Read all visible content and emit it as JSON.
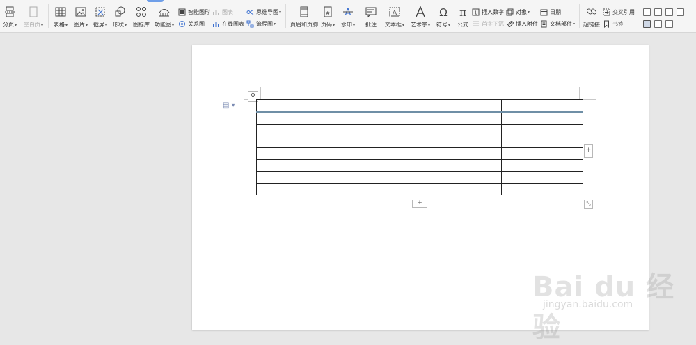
{
  "ribbon": {
    "page_break": "分页",
    "blank_page": "空白页",
    "table": "表格",
    "picture": "图片",
    "screenshot": "截屏",
    "shape": "形状",
    "icon_library": "图标库",
    "function_chart": "功能图",
    "smart_graphic": "智能图形",
    "chart": "图表",
    "relation_chart": "关系图",
    "online_chart": "在线图表",
    "mind_map": "思维导图",
    "flowchart": "流程图",
    "header_footer": "页眉和页脚",
    "page_number": "页码",
    "watermark": "水印",
    "comment": "批注",
    "text_box": "文本框",
    "word_art": "艺术字",
    "symbol": "符号",
    "formula": "公式",
    "insert_number": "插入数字",
    "first_letter_sink": "首字下沉",
    "object": "对象",
    "insert_attachment": "插入附件",
    "date": "日期",
    "doc_parts": "文档部件",
    "hyperlink": "超链接",
    "cross_reference": "交叉引用",
    "bookmark": "书签"
  },
  "document": {
    "table_rows": 8,
    "table_cols": 4
  },
  "watermark": {
    "brand": "Bai du 经验",
    "url": "jingyan.baidu.com"
  }
}
